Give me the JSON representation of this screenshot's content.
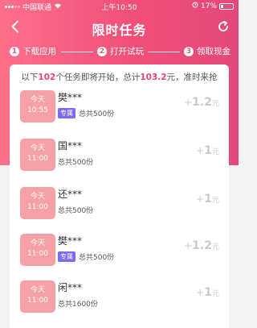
{
  "status": {
    "carrier": "中国联通",
    "time": "上午10:50",
    "battery": "17%"
  },
  "nav": {
    "title": "限时任务"
  },
  "steps": [
    {
      "num": "1",
      "label": "下载应用"
    },
    {
      "num": "2",
      "label": "打开试玩"
    },
    {
      "num": "3",
      "label": "领取现金"
    }
  ],
  "summary": {
    "prefix": "以下",
    "count": "102",
    "middle": "个任务即将开始，总计",
    "total": "103.2",
    "suffix": "元，准时来抢"
  },
  "tasks": [
    {
      "day": "今天",
      "time": "10:55",
      "name": "樊***",
      "badge": "专属",
      "total": "总共500份",
      "plus": "+",
      "amount": "1.2",
      "unit": "元"
    },
    {
      "day": "今天",
      "time": "11:00",
      "name": "国***",
      "badge": "",
      "total": "总共500份",
      "plus": "+",
      "amount": "1",
      "unit": "元"
    },
    {
      "day": "今天",
      "time": "11:00",
      "name": "还***",
      "badge": "",
      "total": "总共500份",
      "plus": "+",
      "amount": "1",
      "unit": "元"
    },
    {
      "day": "今天",
      "time": "11:00",
      "name": "樊***",
      "badge": "专属",
      "total": "总共500份",
      "plus": "+",
      "amount": "1.2",
      "unit": "元"
    },
    {
      "day": "今天",
      "time": "11:00",
      "name": "闲***",
      "badge": "",
      "total": "总共1600份",
      "plus": "+",
      "amount": "1",
      "unit": "元"
    }
  ],
  "colors": {
    "accent": "#f04f79",
    "time_box": "#f6a1a6",
    "badge": "#7b6cf0",
    "reward": "#c9c9c9"
  }
}
